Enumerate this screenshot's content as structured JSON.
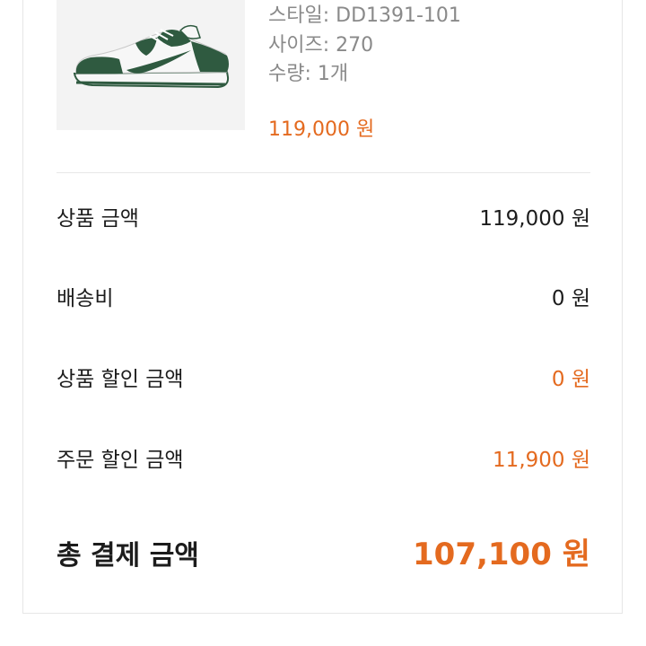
{
  "product": {
    "style": "스타일: DD1391-101",
    "size": "사이즈: 270",
    "quantity": "수량: 1개",
    "price": "119,000 원",
    "image_icon": "sneaker-image",
    "colors": {
      "shoe_green": "#2f5a40",
      "shoe_white": "#f7f7f7",
      "thumb_bg": "#f3f3f3"
    }
  },
  "summary": {
    "rows": [
      {
        "label": "상품 금액",
        "value": "119,000 원"
      },
      {
        "label": "배송비",
        "value": "0 원"
      },
      {
        "label": "상품 할인 금액",
        "value": "0 원"
      },
      {
        "label": "주문 할인 금액",
        "value": "11,900 원"
      }
    ],
    "total": {
      "label": "총 결제 금액",
      "value": "107,100 원"
    }
  },
  "colors": {
    "accent": "#e46a1f",
    "text": "#1c1c1c",
    "muted": "#8a8a8a",
    "divider": "#e8e8e8"
  }
}
